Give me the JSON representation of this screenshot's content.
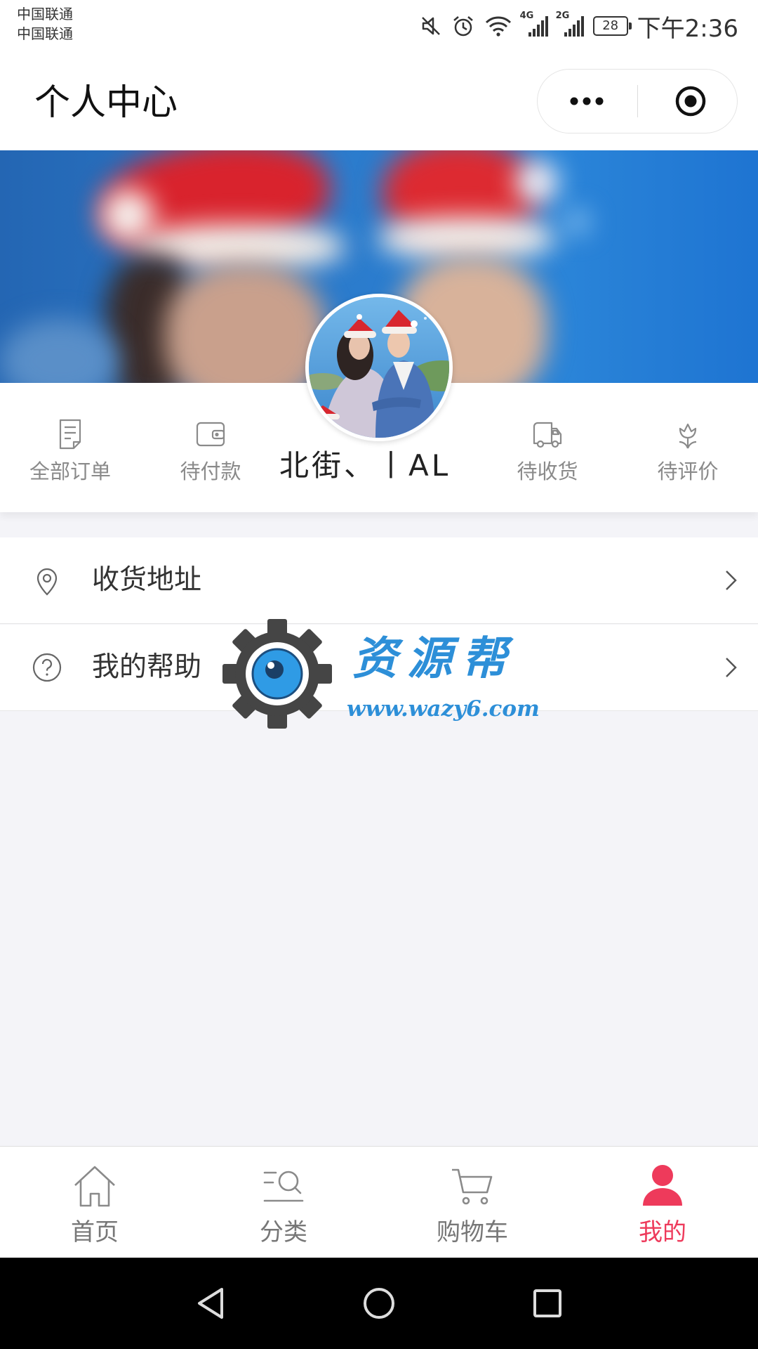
{
  "status_bar": {
    "carrier_1": "中国联通",
    "carrier_2": "中国联通",
    "network_1": "4G",
    "network_2": "2G",
    "battery": "28",
    "time": "下午2:36",
    "icons": [
      "mute-icon",
      "alarm-icon",
      "wifi-icon",
      "signal-icon",
      "signal-icon",
      "battery-icon"
    ]
  },
  "nav": {
    "title": "个人中心",
    "capsule_icons": [
      "more-dots-icon",
      "close-target-icon"
    ]
  },
  "profile": {
    "name": "北街、丨AL"
  },
  "orders": [
    {
      "label": "全部订单",
      "icon": "document-icon"
    },
    {
      "label": "待付款",
      "icon": "wallet-icon"
    },
    {
      "label": "待收货",
      "icon": "delivery-van-icon"
    },
    {
      "label": "待评价",
      "icon": "tulip-icon"
    }
  ],
  "menu": [
    {
      "label": "收货地址",
      "icon": "location-pin-icon"
    },
    {
      "label": "我的帮助",
      "icon": "help-icon"
    }
  ],
  "watermark": {
    "name": "资源帮",
    "url": "www.wazy6.com"
  },
  "tabbar": {
    "items": [
      {
        "label": "首页",
        "icon": "home-icon",
        "active": false
      },
      {
        "label": "分类",
        "icon": "category-search-icon",
        "active": false
      },
      {
        "label": "购物车",
        "icon": "cart-icon",
        "active": false
      },
      {
        "label": "我的",
        "icon": "person-icon",
        "active": true
      }
    ]
  },
  "system_nav": [
    "back-icon",
    "home-circle-icon",
    "recents-icon"
  ],
  "colors": {
    "accent": "#ee3a5b",
    "page_background": "#f4f4f8",
    "muted_text": "#8a8a8a",
    "watermark_blue": "#2d8fd8"
  }
}
